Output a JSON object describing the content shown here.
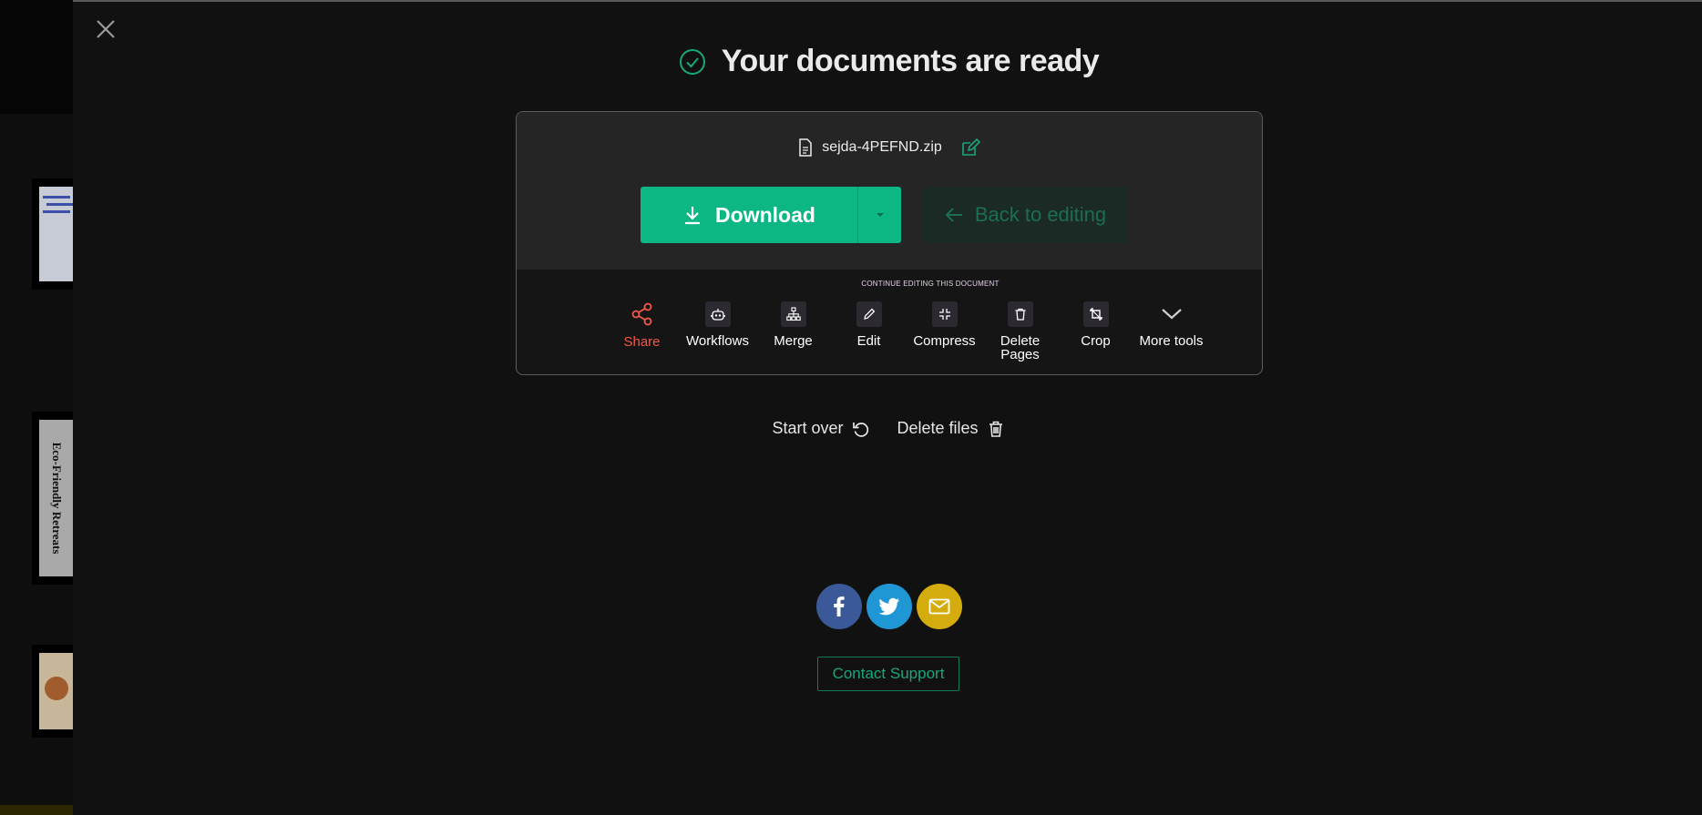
{
  "header": {
    "title": "Your documents are ready"
  },
  "file": {
    "name": "sejda-4PEFND.zip"
  },
  "buttons": {
    "download": "Download",
    "back_to_editing": "Back to editing"
  },
  "continue_label": "CONTINUE EDITING THIS DOCUMENT",
  "tools": [
    {
      "label": "Share",
      "icon": "share-icon"
    },
    {
      "label": "Workflows",
      "icon": "robot-icon"
    },
    {
      "label": "Merge",
      "icon": "sitemap-icon"
    },
    {
      "label": "Edit",
      "icon": "pencil-icon"
    },
    {
      "label": "Compress",
      "icon": "compress-icon"
    },
    {
      "label": "Delete Pages",
      "icon": "trash-icon"
    },
    {
      "label": "Crop",
      "icon": "crop-icon"
    },
    {
      "label": "More tools",
      "icon": "chevron-down-icon"
    }
  ],
  "actions": {
    "start_over": "Start over",
    "delete_files": "Delete files"
  },
  "support": {
    "label": "Contact Support"
  },
  "thumbnails": {
    "page2_text": "Eco-Friendly Retreats"
  },
  "colors": {
    "accent": "#0cb784",
    "share": "#f05a48",
    "facebook": "#3b5998",
    "twitter": "#1f97d4",
    "email": "#d4ac0d"
  }
}
